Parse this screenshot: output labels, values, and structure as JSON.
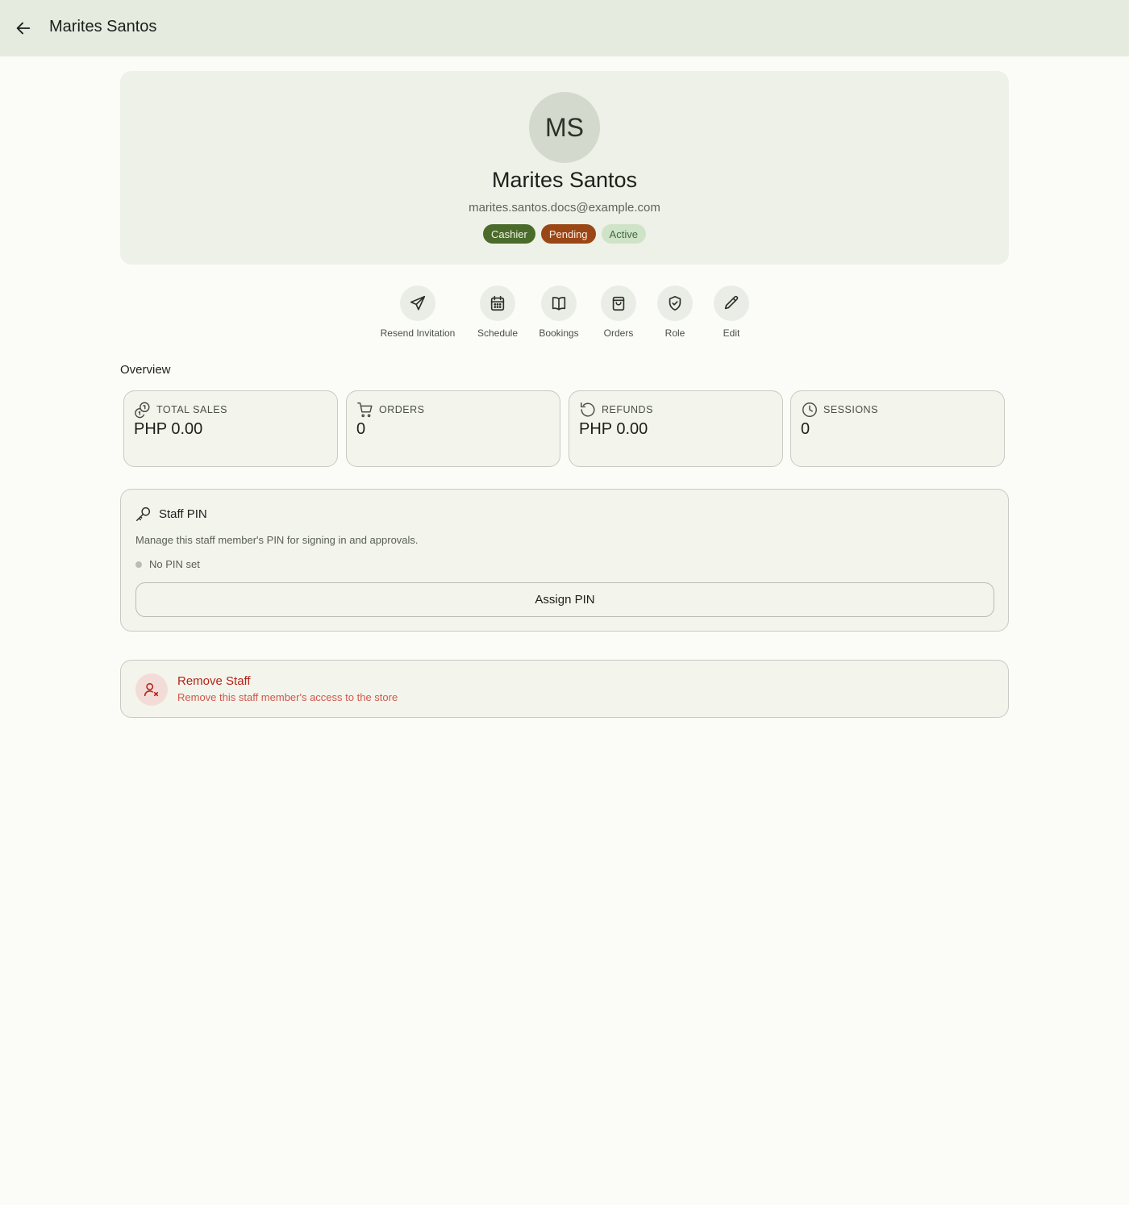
{
  "header": {
    "title": "Marites Santos"
  },
  "profile": {
    "initials": "MS",
    "name": "Marites Santos",
    "email": "marites.santos.docs@example.com",
    "badges": {
      "role": "Cashier",
      "invite": "Pending",
      "status": "Active"
    }
  },
  "actions": [
    {
      "label": "Resend Invitation",
      "icon": "send-icon"
    },
    {
      "label": "Schedule",
      "icon": "calendar-icon"
    },
    {
      "label": "Bookings",
      "icon": "book-icon"
    },
    {
      "label": "Orders",
      "icon": "shopping-bag-icon"
    },
    {
      "label": "Role",
      "icon": "shield-icon"
    },
    {
      "label": "Edit",
      "icon": "pencil-icon"
    }
  ],
  "overview": {
    "title": "Overview",
    "stats": [
      {
        "label": "TOTAL SALES",
        "value": "PHP 0.00",
        "icon": "coins-icon"
      },
      {
        "label": "ORDERS",
        "value": "0",
        "icon": "cart-icon"
      },
      {
        "label": "REFUNDS",
        "value": "PHP 0.00",
        "icon": "rotate-ccw-icon"
      },
      {
        "label": "SESSIONS",
        "value": "0",
        "icon": "clock-icon"
      }
    ]
  },
  "pin": {
    "title": "Staff PIN",
    "description": "Manage this staff member's PIN for signing in and approvals.",
    "status": "No PIN set",
    "button": "Assign PIN"
  },
  "remove": {
    "title": "Remove Staff",
    "subtitle": "Remove this staff member's access to the store"
  },
  "colors": {
    "header_bg": "#e6ebdf",
    "page_bg": "#fbfcf7",
    "role_badge": "#4b6b2b",
    "pending_badge": "#9b4616",
    "active_badge": "#cfe3c8",
    "danger": "#b42318"
  }
}
